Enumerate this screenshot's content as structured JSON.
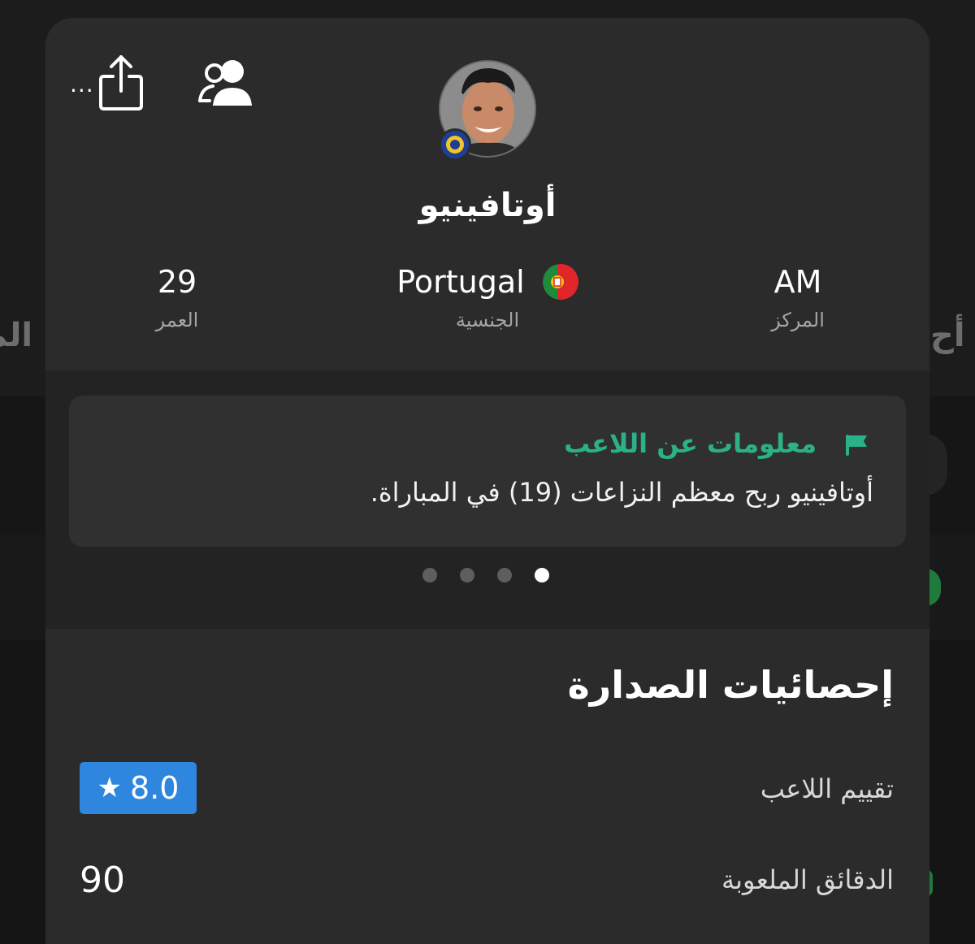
{
  "background": {
    "left_tab_partial": "الم",
    "right_tab_partial": "أح"
  },
  "toolbar": {
    "more_label": "...",
    "icons": [
      "more-icon",
      "share-icon",
      "people-icon"
    ]
  },
  "player": {
    "name": "أوتافينيو",
    "club_badge": "club-badge-icon"
  },
  "stats": {
    "position": {
      "value": "AM",
      "label": "المركز"
    },
    "nationality": {
      "value": "Portugal",
      "label": "الجنسية"
    },
    "age": {
      "value": "29",
      "label": "العمر"
    }
  },
  "info_card": {
    "title": "معلومات عن اللاعب",
    "text": "أوتافينيو ربح معظم النزاعات (19) في المباراة."
  },
  "pagination": {
    "count": 4,
    "active_index": 3
  },
  "top_stats": {
    "title": "إحصائيات الصدارة",
    "rows": [
      {
        "label": "تقييم اللاعب",
        "value": "8.0"
      },
      {
        "label": "الدقائق الملعوبة",
        "value": "90"
      }
    ]
  },
  "colors": {
    "accent_green": "#2ab187",
    "rating_blue": "#2e86de",
    "sheet_bg": "#2b2b2b",
    "card_bg": "#303030"
  }
}
